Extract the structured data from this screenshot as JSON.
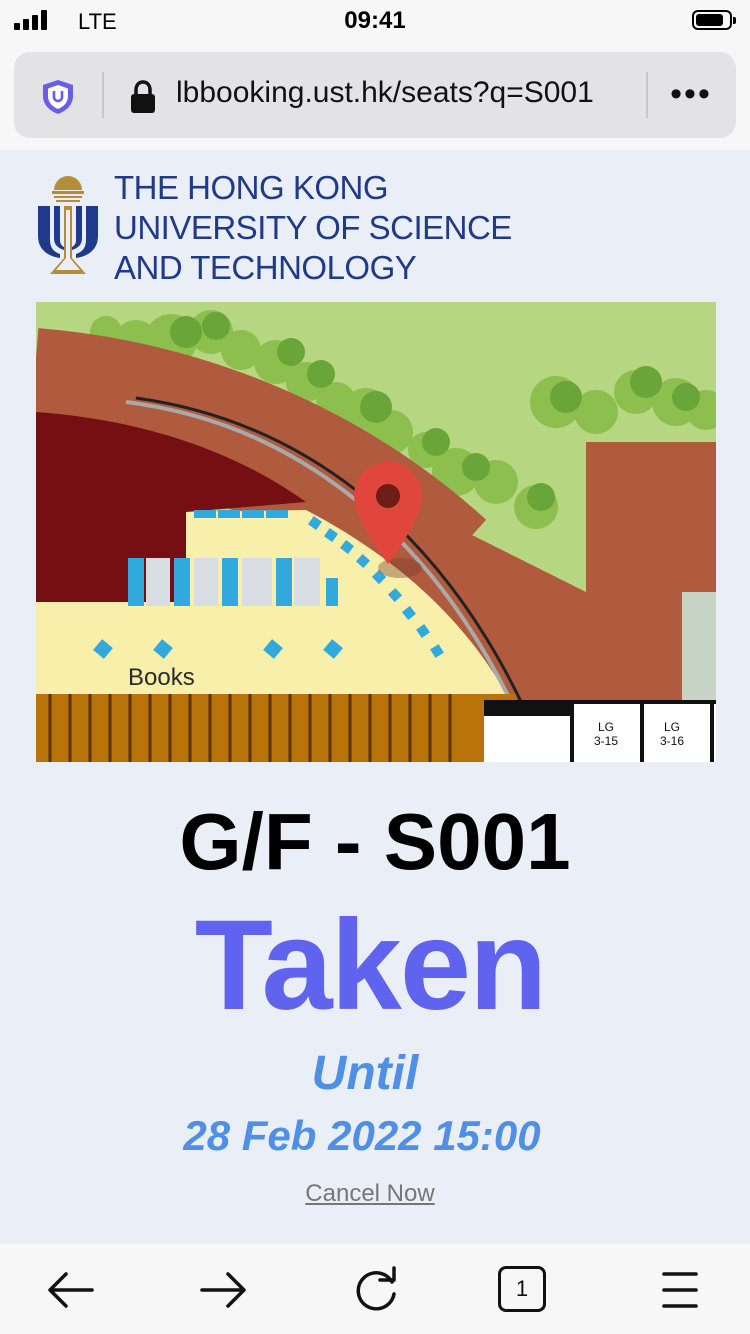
{
  "status_bar": {
    "carrier": "LTE",
    "time": "09:41",
    "battery_level": 0.85
  },
  "browser": {
    "url": "lbbooking.ust.hk/seats?q=S001",
    "shield_icon": "shield-icon",
    "lock_icon": "lock-icon",
    "more_label": "•••",
    "tab_count": "1"
  },
  "logo": {
    "line1": "THE HONG KONG",
    "line2": "UNIVERSITY OF SCIENCE",
    "line3": "AND TECHNOLOGY"
  },
  "map": {
    "books_label": "Books",
    "room_labels": [
      [
        "LG",
        "3-15"
      ],
      [
        "LG",
        "3-16"
      ]
    ],
    "pin_icon": "map-pin-icon"
  },
  "seat": {
    "title": "G/F - S001",
    "status": "Taken",
    "until_label": "Until",
    "until_value": "28 Feb 2022 15:00",
    "cancel_label": "Cancel Now"
  },
  "toolbar": {
    "icons": [
      "back-arrow-icon",
      "forward-arrow-icon",
      "reload-icon",
      "tabs-icon",
      "menu-icon"
    ]
  },
  "colors": {
    "taken": "#5f63ee",
    "until": "#4f8fe6",
    "brand": "#1f3a8a",
    "pin": "#e0463c"
  }
}
